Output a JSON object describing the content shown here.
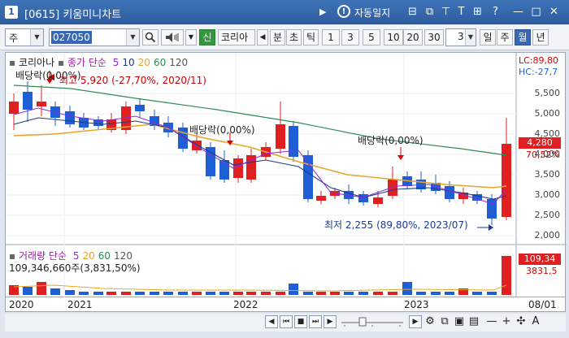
{
  "window": {
    "number": "1",
    "title": "[0615] 키움미니차트",
    "autolock_label": "자동일지",
    "icons": [
      "layout-icon",
      "copy-icon",
      "pin-icon",
      "text-icon",
      "grid-icon",
      "help-icon",
      "minimize-icon",
      "maximize-icon",
      "close-icon"
    ],
    "icon_glyphs": [
      "⊟",
      "⧉",
      "⊤",
      "T",
      "⊞",
      "?",
      "—",
      "□",
      "✕"
    ]
  },
  "toolbar": {
    "market_select": "주",
    "code_value": "027050",
    "shin_label": "신",
    "stock_name": "코리아",
    "period_buttons": [
      "분",
      "초",
      "틱"
    ],
    "number_buttons": [
      "1",
      "3",
      "5",
      "10",
      "20",
      "30"
    ],
    "count_value": "3",
    "tf_buttons": [
      "일",
      "주",
      "월",
      "년"
    ],
    "active_tf": "월"
  },
  "price_panel": {
    "stock_label": "코리아나",
    "ma_prefix": "종가 단순",
    "ma_periods": [
      {
        "label": "5",
        "color": "#8a2be2"
      },
      {
        "label": "10",
        "color": "#1e3a8a"
      },
      {
        "label": "20",
        "color": "#e6a52b"
      },
      {
        "label": "60",
        "color": "#2e8b57"
      },
      {
        "label": "120",
        "color": "#555555"
      }
    ],
    "high_note": "최고 5,920 (-27,70%, 2020/11)",
    "low_note": "최저 2,255 (89,80%, 2023/07)",
    "dividend_labels": [
      "배당락(0,00%)",
      "배당락(0,00%)",
      "배당락(0,00%)"
    ],
    "lc_label": "LC:89,80",
    "hc_label": "HC:-27,7",
    "current_price": "4,280",
    "current_change": "70,52%",
    "y_ticks": [
      "5,500",
      "5,000",
      "4,500",
      "4,000",
      "3,500",
      "3,000",
      "2,500",
      "2,000"
    ]
  },
  "volume_panel": {
    "label": "거래량",
    "ma_prefix": "단순",
    "ma_periods": [
      {
        "label": "5",
        "color": "#8a2be2"
      },
      {
        "label": "20",
        "color": "#e6a52b"
      },
      {
        "label": "60",
        "color": "#2e8b57"
      },
      {
        "label": "120",
        "color": "#555555"
      }
    ],
    "volume_note": "109,346,660주(3,831,50%)",
    "current_volume": "109,34",
    "current_pct": "3831,5"
  },
  "x_axis": {
    "labels": [
      "2020",
      "2021",
      "2022",
      "2023"
    ],
    "date_label": "08/01"
  },
  "colors": {
    "up": "#e02020",
    "down": "#1f5fd6",
    "title_bar": "#2d5c9e"
  }
}
